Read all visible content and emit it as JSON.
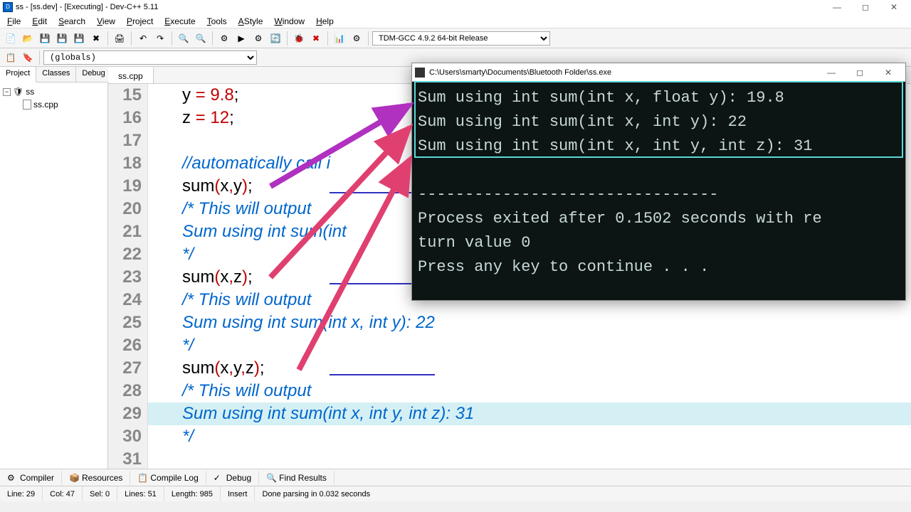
{
  "title": "ss - [ss.dev] - [Executing] - Dev-C++ 5.11",
  "menu": [
    "File",
    "Edit",
    "Search",
    "View",
    "Project",
    "Execute",
    "Tools",
    "AStyle",
    "Window",
    "Help"
  ],
  "compiler_select": "TDM-GCC 4.9.2 64-bit Release",
  "globals": "(globals)",
  "sidebar_tabs": [
    "Project",
    "Classes",
    "Debug"
  ],
  "tree": {
    "root": "ss",
    "file": "ss.cpp"
  },
  "editor_tab": "ss.cpp",
  "lines": [
    {
      "n": 15,
      "tokens": [
        {
          "t": "y ",
          "c": "var"
        },
        {
          "t": "= ",
          "c": "op"
        },
        {
          "t": "9.8",
          "c": "num"
        },
        {
          "t": ";",
          "c": "semi"
        }
      ]
    },
    {
      "n": 16,
      "tokens": [
        {
          "t": "z ",
          "c": "var"
        },
        {
          "t": "= ",
          "c": "op"
        },
        {
          "t": "12",
          "c": "num"
        },
        {
          "t": ";",
          "c": "semi"
        }
      ]
    },
    {
      "n": 17,
      "tokens": []
    },
    {
      "n": 18,
      "tokens": [
        {
          "t": "//automatically call i",
          "c": "cmt"
        }
      ]
    },
    {
      "n": 19,
      "tokens": [
        {
          "t": "sum",
          "c": "fn"
        },
        {
          "t": "(",
          "c": "paren"
        },
        {
          "t": "x",
          "c": "var"
        },
        {
          "t": ",",
          "c": "op"
        },
        {
          "t": "y",
          "c": "var"
        },
        {
          "t": ")",
          "c": "paren"
        },
        {
          "t": ";",
          "c": "semi"
        }
      ]
    },
    {
      "n": 20,
      "tokens": [
        {
          "t": "/* This will output",
          "c": "cmt"
        }
      ]
    },
    {
      "n": 21,
      "tokens": [
        {
          "t": "Sum using int sum(int",
          "c": "cmt"
        }
      ]
    },
    {
      "n": 22,
      "tokens": [
        {
          "t": "*/",
          "c": "cmt"
        }
      ]
    },
    {
      "n": 23,
      "tokens": [
        {
          "t": "sum",
          "c": "fn"
        },
        {
          "t": "(",
          "c": "paren"
        },
        {
          "t": "x",
          "c": "var"
        },
        {
          "t": ",",
          "c": "op"
        },
        {
          "t": "z",
          "c": "var"
        },
        {
          "t": ")",
          "c": "paren"
        },
        {
          "t": ";",
          "c": "semi"
        }
      ]
    },
    {
      "n": 24,
      "tokens": [
        {
          "t": "/* This will output",
          "c": "cmt"
        }
      ]
    },
    {
      "n": 25,
      "tokens": [
        {
          "t": "Sum using int sum(int x, int y): 22",
          "c": "cmt"
        }
      ]
    },
    {
      "n": 26,
      "tokens": [
        {
          "t": "*/",
          "c": "cmt"
        }
      ]
    },
    {
      "n": 27,
      "tokens": [
        {
          "t": "sum",
          "c": "fn"
        },
        {
          "t": "(",
          "c": "paren"
        },
        {
          "t": "x",
          "c": "var"
        },
        {
          "t": ",",
          "c": "op"
        },
        {
          "t": "y",
          "c": "var"
        },
        {
          "t": ",",
          "c": "op"
        },
        {
          "t": "z",
          "c": "var"
        },
        {
          "t": ")",
          "c": "paren"
        },
        {
          "t": ";",
          "c": "semi"
        }
      ]
    },
    {
      "n": 28,
      "tokens": [
        {
          "t": "/* This will output",
          "c": "cmt"
        }
      ]
    },
    {
      "n": 29,
      "hl": true,
      "tokens": [
        {
          "t": "Sum using int sum(int x, int y, int z): 31",
          "c": "cmt"
        }
      ]
    },
    {
      "n": 30,
      "tokens": [
        {
          "t": "*/",
          "c": "cmt"
        }
      ]
    },
    {
      "n": 31,
      "tokens": []
    }
  ],
  "console": {
    "title": "C:\\Users\\smarty\\Documents\\Bluetooth Folder\\ss.exe",
    "lines": [
      "Sum using int sum(int x, float y): 19.8",
      "Sum using int sum(int x, int y): 22",
      "Sum using int sum(int x, int y, int z): 31",
      "",
      "--------------------------------",
      "Process exited after 0.1502 seconds with re",
      "turn value 0",
      "Press any key to continue . . ."
    ]
  },
  "bottom_tabs": [
    "Compiler",
    "Resources",
    "Compile Log",
    "Debug",
    "Find Results"
  ],
  "status": {
    "line": "Line:   29",
    "col": "Col:   47",
    "sel": "Sel:   0",
    "lines": "Lines:   51",
    "length": "Length:   985",
    "mode": "Insert",
    "parse": "Done parsing in 0.032 seconds"
  }
}
